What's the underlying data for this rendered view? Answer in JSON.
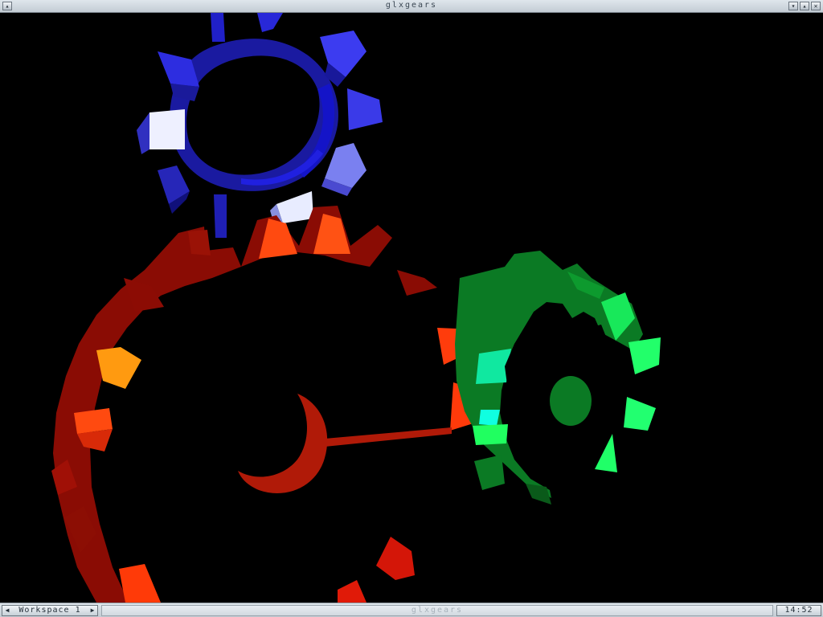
{
  "window": {
    "title": "glxgears",
    "buttons": {
      "menu": "▴",
      "iconify": "▾",
      "maximize": "▴",
      "close": "✕"
    }
  },
  "scene": {
    "gears": [
      {
        "name": "blue-gear",
        "color": "#2a2ad6",
        "highlight": "#b8c0ff"
      },
      {
        "name": "red-gear",
        "color": "#b01a08",
        "highlight": "#ff5a10"
      },
      {
        "name": "green-gear",
        "color": "#0e8a2a",
        "highlight": "#20ff70"
      }
    ]
  },
  "taskbar": {
    "workspace_label": "Workspace 1",
    "prev_icon": "◀",
    "next_icon": "▶",
    "task_label": "glxgears",
    "clock": "14:52"
  }
}
